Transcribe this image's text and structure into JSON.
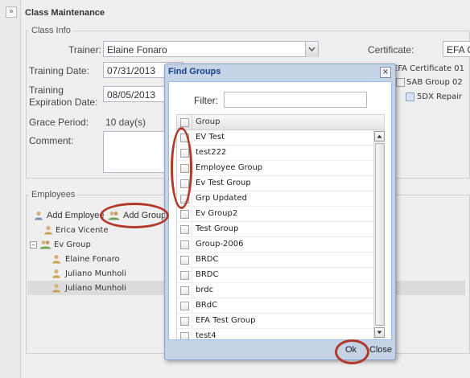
{
  "window": {
    "title": "Class Maintenance",
    "expand_glyph": "»"
  },
  "class_info": {
    "legend": "Class Info",
    "trainer_label": "Trainer:",
    "trainer_value": "Elaine Fonaro",
    "certificate_label": "Certificate:",
    "certificate_value": "EFA C",
    "training_date_label": "Training Date:",
    "training_date_value": "07/31/2013",
    "expiration_label_1": "Training",
    "expiration_label_2": "Expiration Date:",
    "expiration_value": "08/05/2013",
    "grace_label": "Grace Period:",
    "grace_value": "10 day(s)",
    "comment_label": "Comment:",
    "cert_tree": [
      "EFA Certificate 01",
      "SAB Group 02",
      "5DX Repair"
    ]
  },
  "employees": {
    "legend": "Employees",
    "add_employee": "Add Employee",
    "add_group": "Add Group",
    "tree": [
      {
        "label": "Erica Vicente"
      },
      {
        "label": "Ev Group",
        "children": [
          "Elaine Fonaro",
          "Juliano Munholi",
          "Juliano Munholi"
        ]
      }
    ]
  },
  "dialog": {
    "title": "Find Groups",
    "close_glyph": "×",
    "filter_label": "Filter:",
    "filter_value": "",
    "column_header": "Group",
    "groups": [
      "EV Test",
      "test222",
      "Employee Group",
      "Ev Test Group",
      "Grp Updated",
      "Ev Group2",
      "Test Group",
      "Group-2006",
      "BRDC",
      "BRDC",
      "brdc",
      "BRdC",
      "EFA Test Group",
      "test4"
    ],
    "ok_label": "Ok",
    "close_label": "Close"
  },
  "colors": {
    "highlight_circle": "#b23a2a",
    "dialog_title": "#15428b"
  }
}
